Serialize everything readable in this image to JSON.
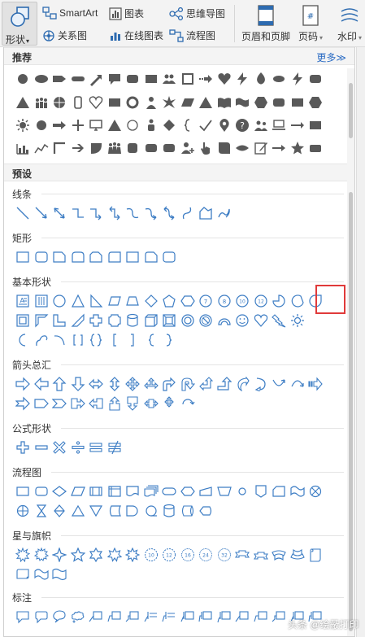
{
  "ribbon": {
    "shape_label": "形状",
    "smartart_label": "SmartArt",
    "chart_label": "图表",
    "mindmap_label": "思维导图",
    "relation_label": "关系图",
    "online_chart_label": "在线图表",
    "flowchart_label": "流程图",
    "header_footer_label": "页眉和页脚",
    "page_number_label": "页码",
    "watermark_label": "水印"
  },
  "sections": {
    "recommended": "推荐",
    "more": "更多≫",
    "preset": "预设"
  },
  "categories": {
    "lines": "线条",
    "rect": "矩形",
    "basic": "基本形状",
    "arrows": "箭头总汇",
    "formula": "公式形状",
    "flowchart": "流程图",
    "stars": "星与旗帜",
    "callouts": "标注"
  },
  "watermark_text": "头条 @绘蔽打印",
  "accent_colors": {
    "shape_blue": "#3d7dc4",
    "shape_gray": "#595959",
    "highlight": "#e03a3a",
    "link": "#2b6cc4"
  }
}
